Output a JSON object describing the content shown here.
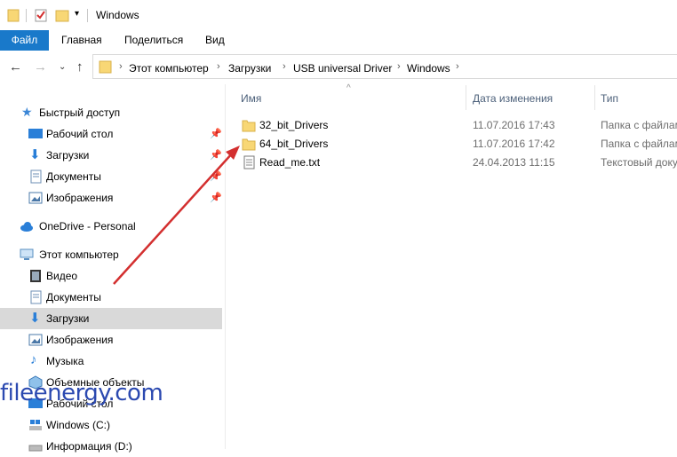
{
  "titlebar": {
    "title": "Windows"
  },
  "ribbon": {
    "file": "Файл",
    "home": "Главная",
    "share": "Поделиться",
    "view": "Вид"
  },
  "address": {
    "crumbs": [
      "Этот компьютер",
      "Загрузки",
      "USB universal Driver",
      "Windows"
    ]
  },
  "sidebar": {
    "quick_access": "Быстрый доступ",
    "quick_items": [
      "Рабочий стол",
      "Загрузки",
      "Документы",
      "Изображения"
    ],
    "onedrive": "OneDrive - Personal",
    "this_pc": "Этот компьютер",
    "pc_items": [
      "Видео",
      "Документы",
      "Загрузки",
      "Изображения",
      "Музыка",
      "Объемные объекты",
      "Рабочий стол",
      "Windows (C:)",
      "Информация (D:)"
    ]
  },
  "columns": {
    "name": "Имя",
    "date": "Дата изменения",
    "type": "Тип"
  },
  "files": [
    {
      "name": "32_bit_Drivers",
      "date": "11.07.2016 17:43",
      "type": "Папка с файлами",
      "icon": "folder-icon"
    },
    {
      "name": "64_bit_Drivers",
      "date": "11.07.2016 17:42",
      "type": "Папка с файлами",
      "icon": "folder-icon"
    },
    {
      "name": "Read_me.txt",
      "date": "24.04.2013 11:15",
      "type": "Текстовый документ",
      "icon": "text-file-icon"
    }
  ],
  "watermark": "fileenergy.com",
  "colors": {
    "accent": "#1979ca",
    "arrow": "#d32f2f",
    "folder": "#f8d775",
    "selected": "#d9d9d9"
  }
}
